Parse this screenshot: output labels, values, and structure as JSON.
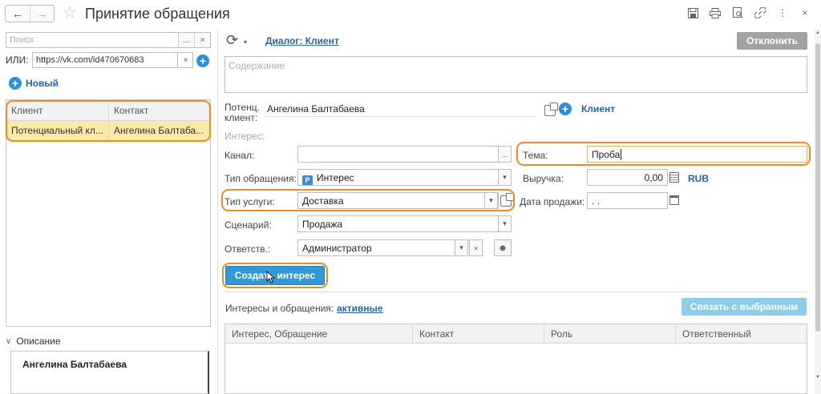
{
  "window": {
    "title": "Принятие обращения",
    "back_icon": "←",
    "forward_icon": "→",
    "star_icon": "☆",
    "toolbar_icons": [
      "save-icon",
      "print-icon",
      "preview-icon",
      "link-icon",
      "more-icon",
      "close-icon"
    ]
  },
  "left": {
    "search_placeholder": "Поиск",
    "search_more": "...",
    "search_clear": "×",
    "ili_label": "ИЛИ:",
    "ili_value": "https://vk.com/id470670683",
    "ili_clear": "×",
    "new_label": "Новый",
    "table": {
      "columns": [
        "Клиент",
        "Контакт"
      ],
      "rows": [
        [
          "Потенциальный кл...",
          "Ангелина Балтаба..."
        ]
      ]
    },
    "description_label": "Описание",
    "description_value": "Ангелина Балтабаева"
  },
  "right": {
    "dialog_link": "Диалог: Клиент",
    "reject_label": "Отклонить",
    "content_placeholder": "Содержание",
    "potential_client_label": "Потенц. клиент:",
    "potential_client_value": "Ангелина Балтабаева",
    "client_link": "Клиент",
    "interest_section": "Интерес:",
    "channel_label": "Канал:",
    "channel_value": "",
    "topic_label": "Тема:",
    "topic_value": "Проба",
    "request_type_label": "Тип обращения:",
    "request_type_value": "Интерес",
    "revenue_label": "Выручка:",
    "revenue_value": "0,00",
    "currency": "RUB",
    "service_type_label": "Тип услуги:",
    "service_type_value": "Доставка",
    "sale_date_label": "Дата продажи:",
    "sale_date_value": " .  .",
    "scenario_label": "Сценарий:",
    "scenario_value": "Продажа",
    "responsible_label": "Ответств.:",
    "responsible_value": "Администратор",
    "create_interest_label": "Создать интерес",
    "interests_label": "Интересы и обращения:",
    "interests_filter": "активные",
    "link_selected_label": "Связать с выбранным",
    "table_columns": [
      "Интерес, Обращение",
      "Контакт",
      "Роль",
      "Ответственный"
    ]
  },
  "colors": {
    "accent_blue": "#2d8fdb",
    "link_blue": "#2266aa",
    "highlight_orange": "#f08a24",
    "selected_row": "#fbe9a6"
  }
}
